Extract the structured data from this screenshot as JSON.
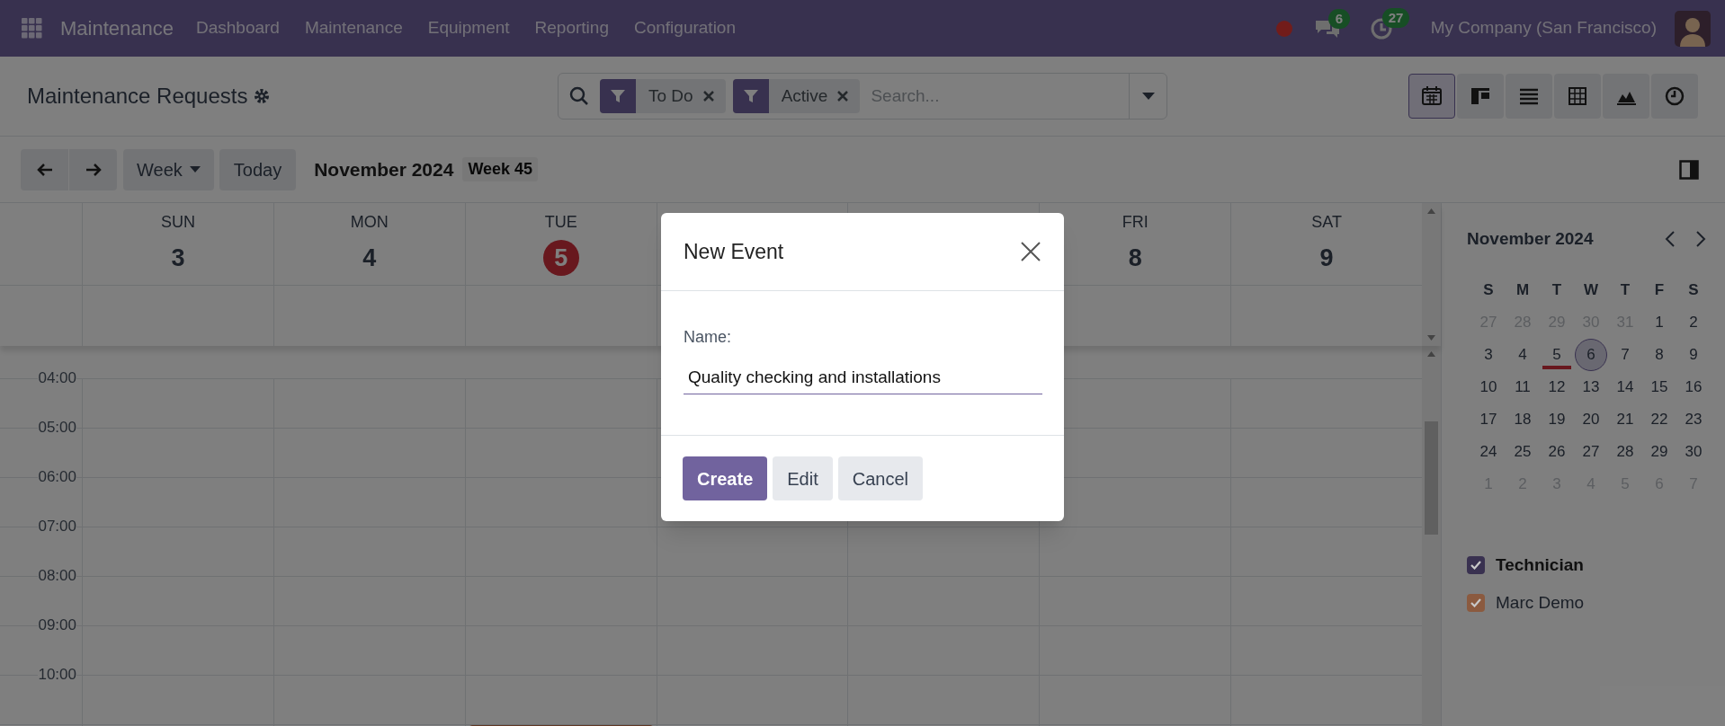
{
  "navbar": {
    "app_name": "Maintenance",
    "menu": [
      "Dashboard",
      "Maintenance",
      "Equipment",
      "Reporting",
      "Configuration"
    ],
    "messages_count": "6",
    "activities_count": "27",
    "company": "My Company (San Francisco)"
  },
  "control_panel": {
    "title": "Maintenance Requests",
    "facets": [
      {
        "label": "To Do"
      },
      {
        "label": "Active"
      }
    ],
    "search_placeholder": "Search...",
    "views": [
      {
        "kind": "calendar",
        "selected": true
      },
      {
        "kind": "kanban",
        "selected": false
      },
      {
        "kind": "list",
        "selected": false
      },
      {
        "kind": "pivot",
        "selected": false
      },
      {
        "kind": "graph",
        "selected": false
      },
      {
        "kind": "activity",
        "selected": false
      }
    ]
  },
  "toolbar": {
    "scale": "Week",
    "today": "Today",
    "period": "November 2024",
    "week": "Week 45"
  },
  "week_view": {
    "days": [
      {
        "weekday": "SUN",
        "date": "3",
        "today": false
      },
      {
        "weekday": "MON",
        "date": "4",
        "today": false
      },
      {
        "weekday": "TUE",
        "date": "5",
        "today": true
      },
      {
        "covered": true
      },
      {
        "covered": true
      },
      {
        "weekday": "FRI",
        "date": "8",
        "today": false
      },
      {
        "weekday": "SAT",
        "date": "9",
        "today": false
      }
    ],
    "hours": [
      "04:00",
      "05:00",
      "06:00",
      "07:00",
      "08:00",
      "09:00",
      "10:00"
    ]
  },
  "mini_calendar": {
    "title": "November 2024",
    "weekdays": [
      "S",
      "M",
      "T",
      "W",
      "T",
      "F",
      "S"
    ],
    "weeks": [
      [
        {
          "day": "27",
          "other_month": true,
          "today": false,
          "selected": false
        },
        {
          "day": "28",
          "other_month": true,
          "today": false,
          "selected": false
        },
        {
          "day": "29",
          "other_month": true,
          "today": false,
          "selected": false
        },
        {
          "day": "30",
          "other_month": true,
          "today": false,
          "selected": false
        },
        {
          "day": "31",
          "other_month": true,
          "today": false,
          "selected": false
        },
        {
          "day": "1",
          "other_month": false,
          "today": false,
          "selected": false
        },
        {
          "day": "2",
          "other_month": false,
          "today": false,
          "selected": false
        }
      ],
      [
        {
          "day": "3",
          "other_month": false,
          "today": false,
          "selected": false
        },
        {
          "day": "4",
          "other_month": false,
          "today": false,
          "selected": false
        },
        {
          "day": "5",
          "other_month": false,
          "today": true,
          "selected": false
        },
        {
          "day": "6",
          "other_month": false,
          "today": false,
          "selected": true
        },
        {
          "day": "7",
          "other_month": false,
          "today": false,
          "selected": false
        },
        {
          "day": "8",
          "other_month": false,
          "today": false,
          "selected": false
        },
        {
          "day": "9",
          "other_month": false,
          "today": false,
          "selected": false
        }
      ],
      [
        {
          "day": "10",
          "other_month": false,
          "today": false,
          "selected": false
        },
        {
          "day": "11",
          "other_month": false,
          "today": false,
          "selected": false
        },
        {
          "day": "12",
          "other_month": false,
          "today": false,
          "selected": false
        },
        {
          "day": "13",
          "other_month": false,
          "today": false,
          "selected": false
        },
        {
          "day": "14",
          "other_month": false,
          "today": false,
          "selected": false
        },
        {
          "day": "15",
          "other_month": false,
          "today": false,
          "selected": false
        },
        {
          "day": "16",
          "other_month": false,
          "today": false,
          "selected": false
        }
      ],
      [
        {
          "day": "17",
          "other_month": false,
          "today": false,
          "selected": false
        },
        {
          "day": "18",
          "other_month": false,
          "today": false,
          "selected": false
        },
        {
          "day": "19",
          "other_month": false,
          "today": false,
          "selected": false
        },
        {
          "day": "20",
          "other_month": false,
          "today": false,
          "selected": false
        },
        {
          "day": "21",
          "other_month": false,
          "today": false,
          "selected": false
        },
        {
          "day": "22",
          "other_month": false,
          "today": false,
          "selected": false
        },
        {
          "day": "23",
          "other_month": false,
          "today": false,
          "selected": false
        }
      ],
      [
        {
          "day": "24",
          "other_month": false,
          "today": false,
          "selected": false
        },
        {
          "day": "25",
          "other_month": false,
          "today": false,
          "selected": false
        },
        {
          "day": "26",
          "other_month": false,
          "today": false,
          "selected": false
        },
        {
          "day": "27",
          "other_month": false,
          "today": false,
          "selected": false
        },
        {
          "day": "28",
          "other_month": false,
          "today": false,
          "selected": false
        },
        {
          "day": "29",
          "other_month": false,
          "today": false,
          "selected": false
        },
        {
          "day": "30",
          "other_month": false,
          "today": false,
          "selected": false
        }
      ],
      [
        {
          "day": "1",
          "other_month": true,
          "today": false,
          "selected": false
        },
        {
          "day": "2",
          "other_month": true,
          "today": false,
          "selected": false
        },
        {
          "day": "3",
          "other_month": true,
          "today": false,
          "selected": false
        },
        {
          "day": "4",
          "other_month": true,
          "today": false,
          "selected": false
        },
        {
          "day": "5",
          "other_month": true,
          "today": false,
          "selected": false
        },
        {
          "day": "6",
          "other_month": true,
          "today": false,
          "selected": false
        },
        {
          "day": "7",
          "other_month": true,
          "today": false,
          "selected": false
        }
      ]
    ]
  },
  "filters": [
    {
      "label": "Technician",
      "kind": "header",
      "checked": true,
      "color": "#393150"
    },
    {
      "label": "Marc Demo",
      "kind": "item",
      "checked": true,
      "color": "#8b5a3f"
    }
  ],
  "dialog": {
    "title": "New Event",
    "field_label": "Name:",
    "value": "Quality checking and installations",
    "buttons": [
      {
        "label": "Create",
        "kind": "primary"
      },
      {
        "label": "Edit",
        "kind": "secondary"
      },
      {
        "label": "Cancel",
        "kind": "secondary"
      }
    ]
  }
}
